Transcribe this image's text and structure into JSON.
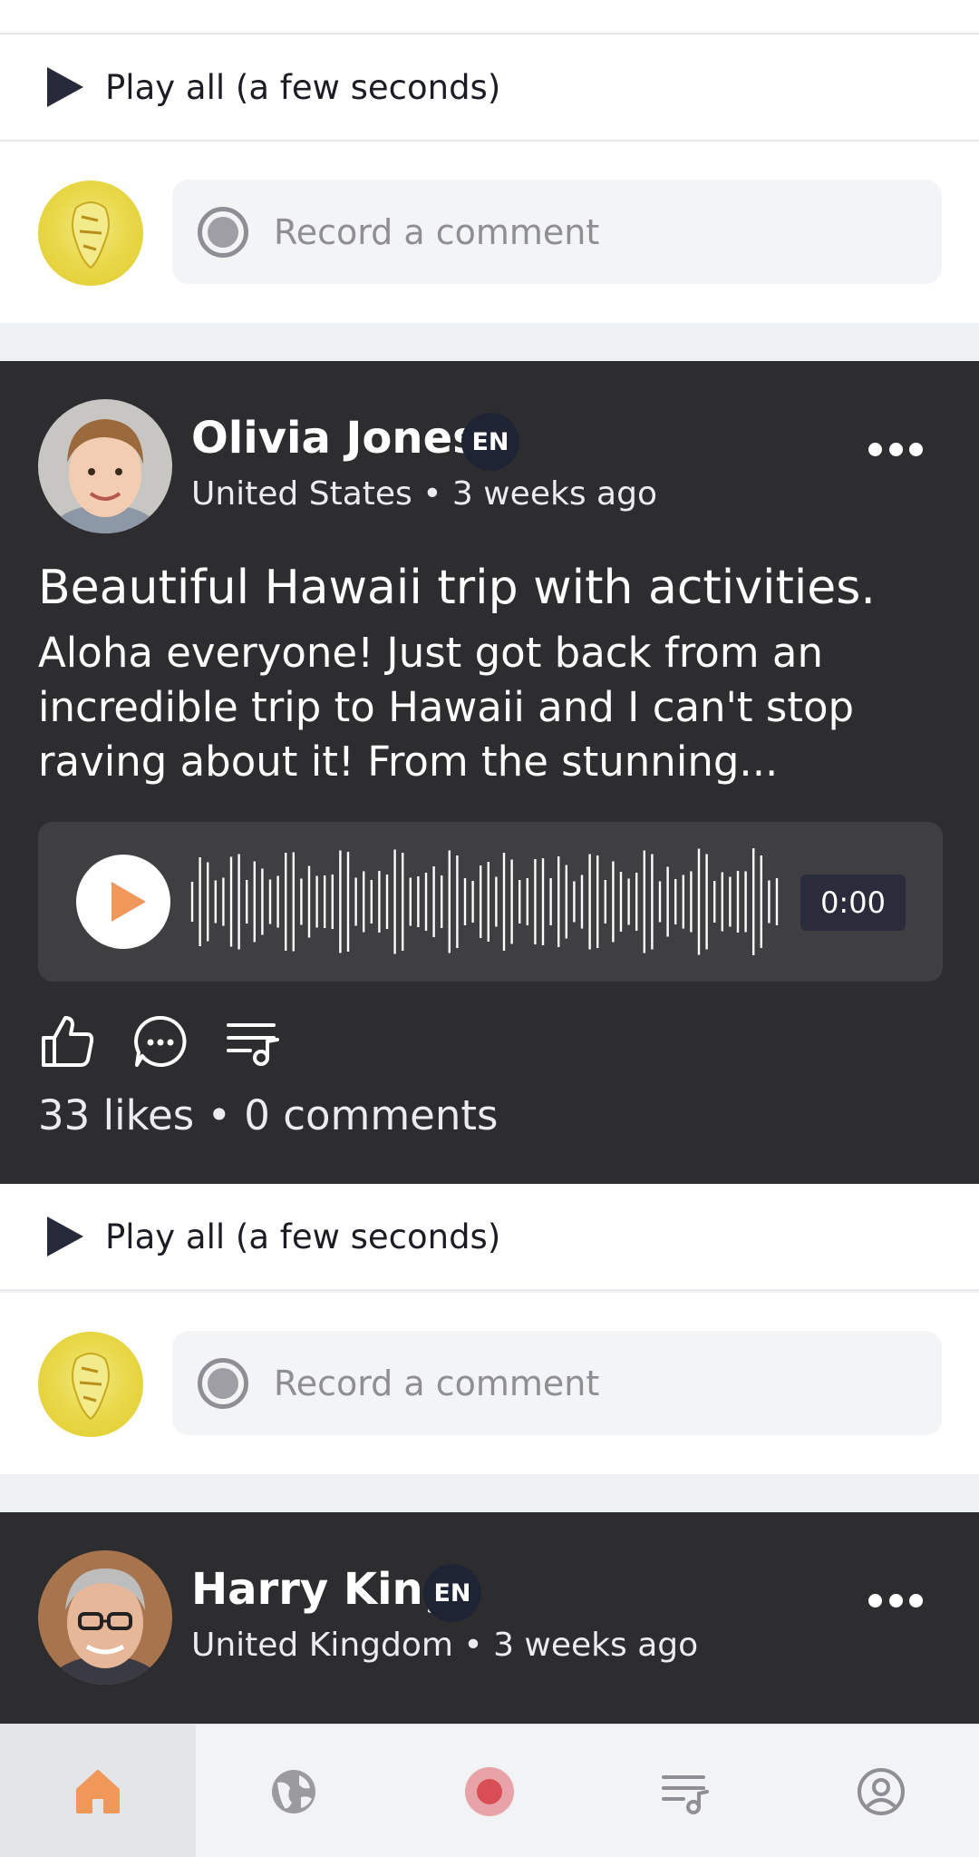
{
  "feed": {
    "play_all_label": "Play all (a few seconds)",
    "comment_placeholder": "Record a comment",
    "posts": [
      {
        "author": "Olivia Jones",
        "language": "EN",
        "meta": "United States • 3 weeks ago",
        "title": "Beautiful Hawaii trip with activities.",
        "body": "Aloha everyone! Just got back from an incredible trip to Hawaii and I can't stop raving about it! From the stunning...",
        "duration": "0:00",
        "stats": "33 likes • 0 comments"
      },
      {
        "author": "Harry King",
        "language": "EN",
        "meta": "United Kingdom • 3 weeks ago"
      }
    ]
  },
  "tabs": {
    "items": [
      {
        "icon": "home-icon",
        "active": true
      },
      {
        "icon": "globe-icon",
        "active": false
      },
      {
        "icon": "record-icon",
        "active": false
      },
      {
        "icon": "playlist-icon",
        "active": false
      },
      {
        "icon": "profile-icon",
        "active": false
      }
    ]
  },
  "colors": {
    "accent": "#f0975a",
    "card_dark": "#2d2d2f",
    "language_badge": "#1f2435",
    "record_red": "#d94d55"
  }
}
